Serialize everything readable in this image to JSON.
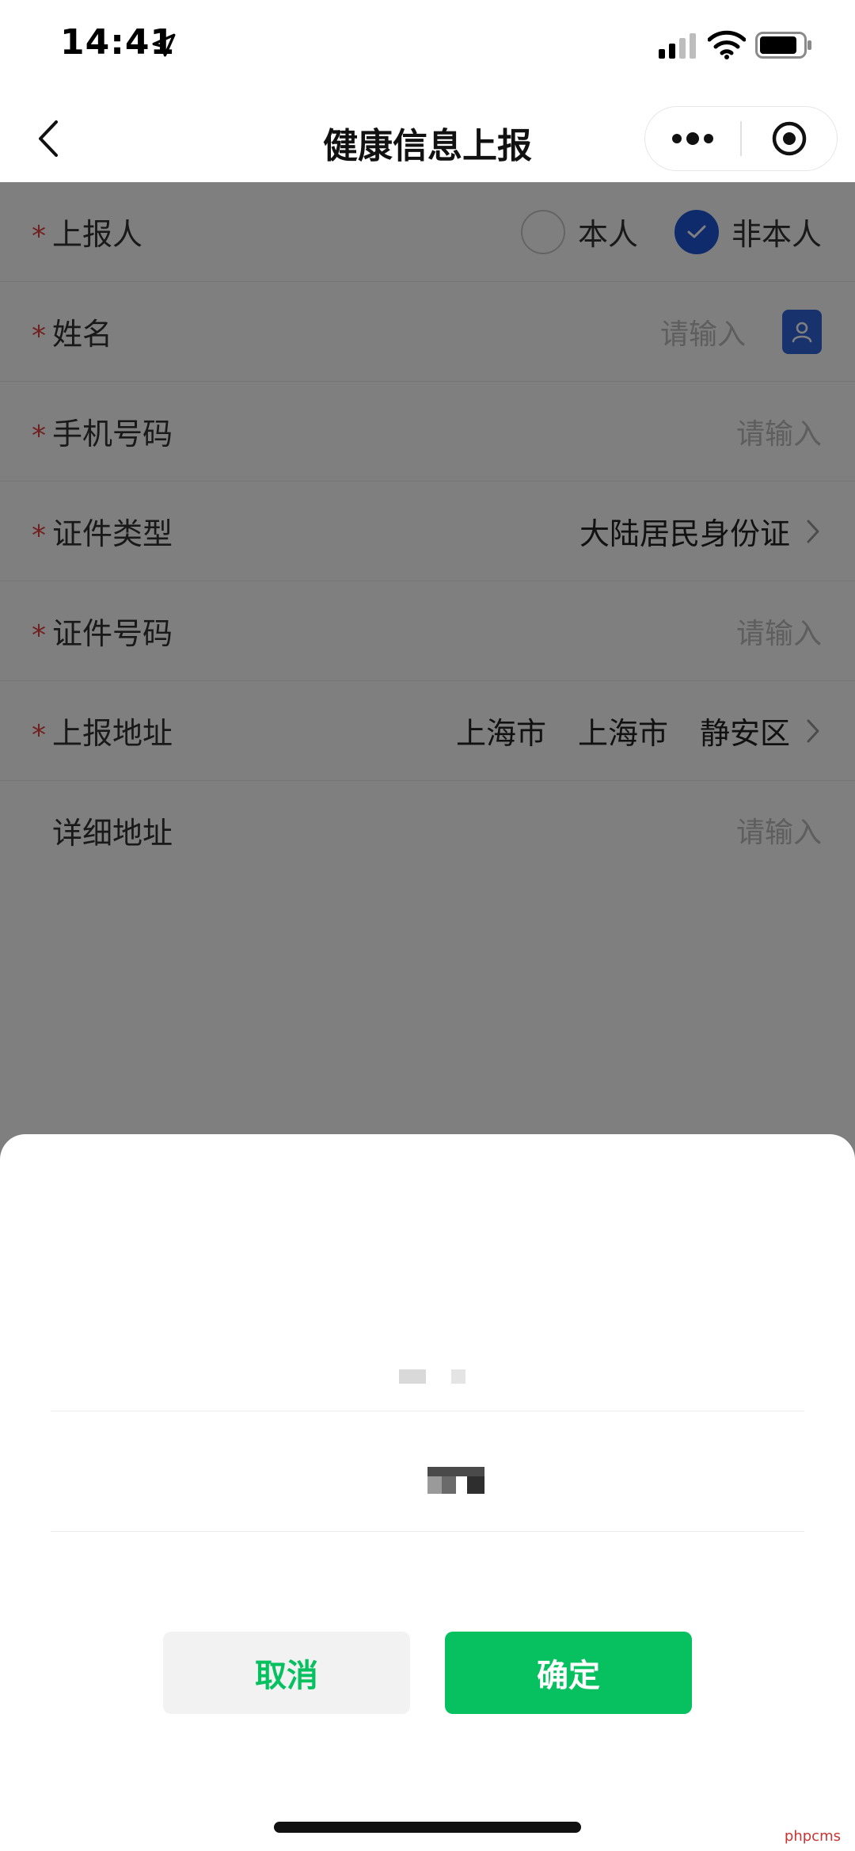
{
  "status_bar": {
    "time": "14:41",
    "icons": [
      "location-arrow-icon",
      "signal-icon",
      "wifi-icon",
      "battery-icon"
    ]
  },
  "nav": {
    "title": "健康信息上报",
    "back_icon": "chevron-left-icon",
    "more_icon": "more-dots-icon",
    "close_icon": "target-close-icon"
  },
  "form": {
    "required_mark": "*",
    "reporter": {
      "label": "上报人",
      "options": [
        {
          "label": "本人",
          "checked": false
        },
        {
          "label": "非本人",
          "checked": true
        }
      ]
    },
    "name": {
      "label": "姓名",
      "placeholder": "请输入",
      "contact_icon": "contact-book-icon"
    },
    "phone": {
      "label": "手机号码",
      "placeholder": "请输入"
    },
    "id_type": {
      "label": "证件类型",
      "value": "大陆居民身份证"
    },
    "id_number": {
      "label": "证件号码",
      "placeholder": "请输入"
    },
    "address": {
      "label": "上报地址",
      "province": "上海市",
      "city": "上海市",
      "district": "静安区"
    },
    "detail_address": {
      "label": "详细地址",
      "placeholder": "请输入"
    }
  },
  "sheet": {
    "cancel_label": "取消",
    "confirm_label": "确定"
  },
  "watermark": "phpcms",
  "colors": {
    "accent_blue": "#1e57d8",
    "wechat_green": "#07c160",
    "required_red": "#e34040",
    "mask": "rgba(0,0,0,0.5)"
  }
}
